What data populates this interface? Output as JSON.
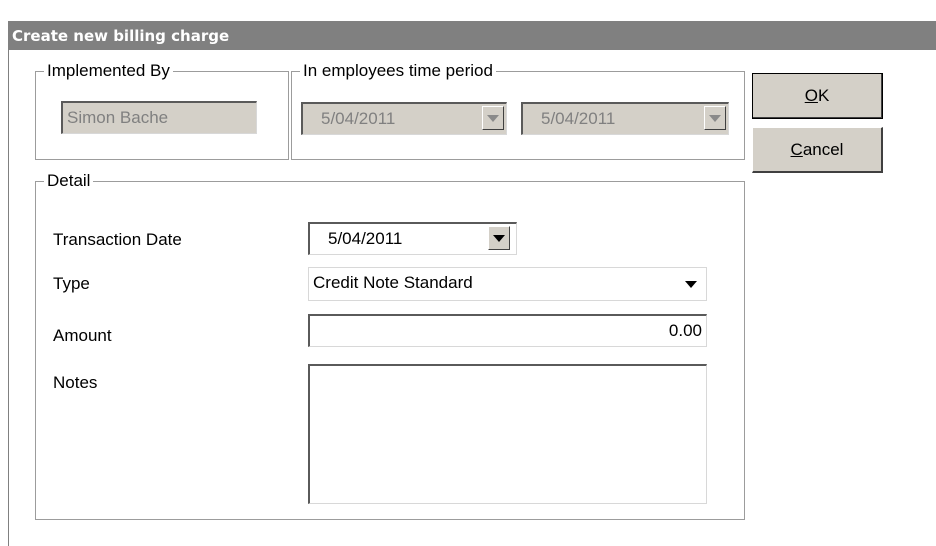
{
  "dialog": {
    "title": "Create new billing charge",
    "implemented_by": {
      "legend": "Implemented By",
      "value": "Simon Bache"
    },
    "time_period": {
      "legend": "In employees time period",
      "from": "5/04/2011",
      "to": "5/04/2011"
    },
    "detail": {
      "legend": "Detail",
      "transaction_date_label": "Transaction Date",
      "transaction_date_value": "5/04/2011",
      "type_label": "Type",
      "type_value": "Credit Note Standard",
      "amount_label": "Amount",
      "amount_value": "0.00",
      "notes_label": "Notes",
      "notes_value": ""
    },
    "buttons": {
      "ok_mnemonic": "O",
      "ok_rest": "K",
      "cancel_mnemonic": "C",
      "cancel_rest": "ancel"
    }
  },
  "colors": {
    "titlebar": "#808080",
    "face": "#d4d0c8"
  },
  "icons": {
    "dropdown": "chevron-down-icon"
  }
}
